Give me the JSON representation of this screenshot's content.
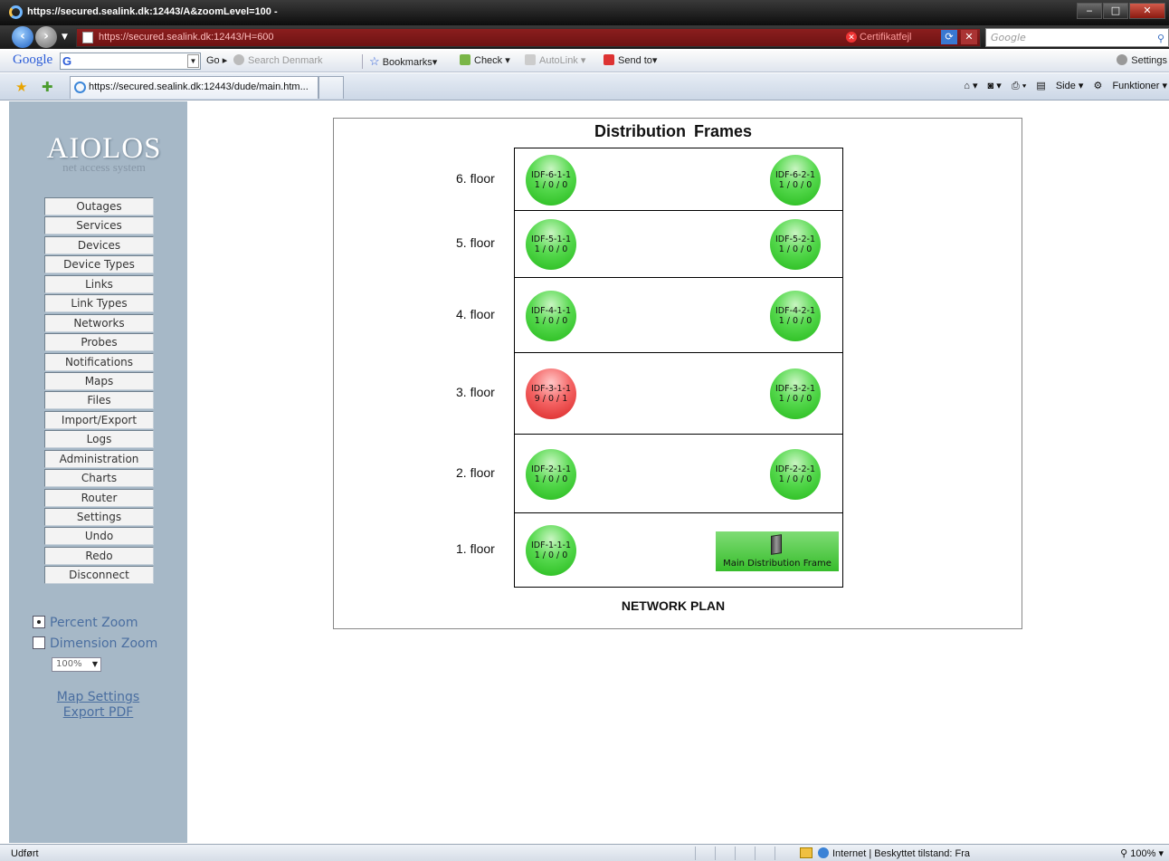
{
  "window": {
    "title": "https://secured.sealink.dk:12443/A&zoomLevel=100 -"
  },
  "address_bar": {
    "url": "https://secured.sealink.dk:12443/H=600",
    "cert_error": "Certifikatfejl",
    "search_placeholder": "Google"
  },
  "google_toolbar": {
    "logo": "Google",
    "go": "Go",
    "search_denmark": "Search Denmark",
    "bookmarks": "Bookmarks",
    "check": "Check",
    "autolink": "AutoLink",
    "send_to": "Send to",
    "settings": "Settings"
  },
  "tab": {
    "title": "https://secured.sealink.dk:12443/dude/main.htm..."
  },
  "command_bar": {
    "page": "Side",
    "tools": "Funktioner"
  },
  "sidebar": {
    "logo_title": "AIOLOS",
    "logo_subtitle": "net access system",
    "menu": [
      "Outages",
      "Services",
      "Devices",
      "Device Types",
      "Links",
      "Link Types",
      "Networks",
      "Probes",
      "Notifications",
      "Maps",
      "Files",
      "Import/Export",
      "Logs",
      "Administration",
      "Charts",
      "Router",
      "Settings",
      "Undo",
      "Redo",
      "Disconnect"
    ],
    "zoom_percent_label": "Percent Zoom",
    "zoom_dimension_label": "Dimension Zoom",
    "zoom_mode_selected": "Percent Zoom",
    "zoom_value": "100%",
    "map_settings_link": "Map Settings",
    "export_pdf_link": "Export PDF"
  },
  "map": {
    "title": "Distribution  Frames",
    "caption": "NETWORK PLAN",
    "floors": [
      {
        "label": "6. floor",
        "left": {
          "name": "IDF-6-1-1",
          "status": "1 / 0 / 0",
          "state": "up"
        },
        "right": {
          "name": "IDF-6-2-1",
          "status": "1 / 0 / 0",
          "state": "up"
        }
      },
      {
        "label": "5. floor",
        "left": {
          "name": "IDF-5-1-1",
          "status": "1 / 0 / 0",
          "state": "up"
        },
        "right": {
          "name": "IDF-5-2-1",
          "status": "1 / 0 / 0",
          "state": "up"
        }
      },
      {
        "label": "4. floor",
        "left": {
          "name": "IDF-4-1-1",
          "status": "1 / 0 / 0",
          "state": "up"
        },
        "right": {
          "name": "IDF-4-2-1",
          "status": "1 / 0 / 0",
          "state": "up"
        }
      },
      {
        "label": "3. floor",
        "left": {
          "name": "IDF-3-1-1",
          "status": "9 / 0 / 1",
          "state": "down"
        },
        "right": {
          "name": "IDF-3-2-1",
          "status": "1 / 0 / 0",
          "state": "up"
        }
      },
      {
        "label": "2. floor",
        "left": {
          "name": "IDF-2-1-1",
          "status": "1 / 0 / 0",
          "state": "up"
        },
        "right": {
          "name": "IDF-2-2-1",
          "status": "1 / 0 / 0",
          "state": "up"
        }
      },
      {
        "label": "1. floor",
        "left": {
          "name": "IDF-1-1-1",
          "status": "1 / 0 / 0",
          "state": "up"
        },
        "right": {
          "name": "Main Distribution Frame",
          "state": "up"
        }
      }
    ]
  },
  "status_bar": {
    "status": "Udført",
    "zone": "Internet | Beskyttet tilstand: Fra",
    "zoom": "100%"
  },
  "colors": {
    "sidebar_bg": "#a6b8c7",
    "node_up": "#2fc024",
    "node_down": "#e03a3a",
    "link": "#4a6ea0"
  }
}
